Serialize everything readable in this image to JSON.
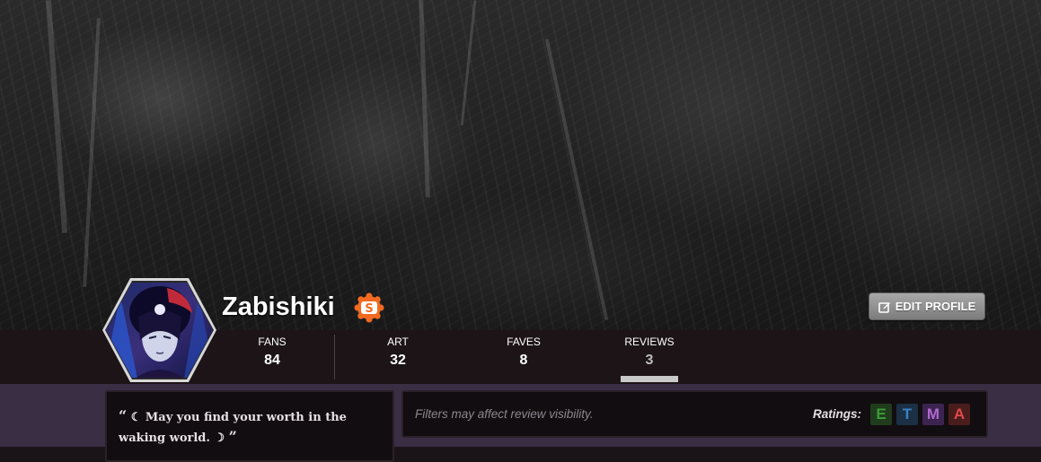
{
  "profile": {
    "username": "Zabishiki",
    "badge_letter": "S",
    "edit_label": "EDIT PROFILE"
  },
  "stats": [
    {
      "label": "FANS",
      "value": "84"
    },
    {
      "label": "ART",
      "value": "32"
    },
    {
      "label": "FAVES",
      "value": "8"
    },
    {
      "label": "REVIEWS",
      "value": "3"
    }
  ],
  "active_tab": "REVIEWS",
  "quote": {
    "open_mark": "“",
    "text": "☾ May you find your worth in the waking world. ☽",
    "close_mark": "”"
  },
  "filters": {
    "note": "Filters may affect review visibility.",
    "ratings_label": "Ratings:",
    "ratings": [
      {
        "letter": "E",
        "color": "#3f9b3a",
        "bg": "#1f3d1c"
      },
      {
        "letter": "T",
        "color": "#3b82c4",
        "bg": "#1b2f45"
      },
      {
        "letter": "M",
        "color": "#b06ad0",
        "bg": "#3c2450"
      },
      {
        "letter": "A",
        "color": "#e04848",
        "bg": "#4a1d1d"
      }
    ]
  },
  "colors": {
    "badge_orange": "#f26a21",
    "lower_bg": "#3a2e45",
    "statbar_bg": "#1c1417"
  }
}
